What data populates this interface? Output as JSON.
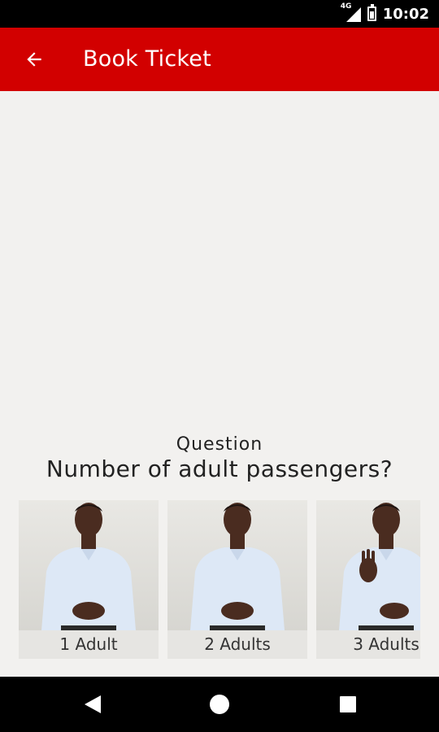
{
  "status_bar": {
    "network": "4G",
    "time": "10:02"
  },
  "header": {
    "title": "Book Ticket",
    "back_icon": "arrow-back-icon"
  },
  "question": {
    "label": "Question",
    "text": "Number of adult passengers?"
  },
  "options": [
    {
      "label": "1 Adult",
      "icon": "sign-language-video"
    },
    {
      "label": "2 Adults",
      "icon": "sign-language-video"
    },
    {
      "label": "3 Adults",
      "icon": "sign-language-video"
    }
  ],
  "colors": {
    "primary": "#d20000",
    "background": "#f2f1ef",
    "status_bar": "#000000"
  }
}
